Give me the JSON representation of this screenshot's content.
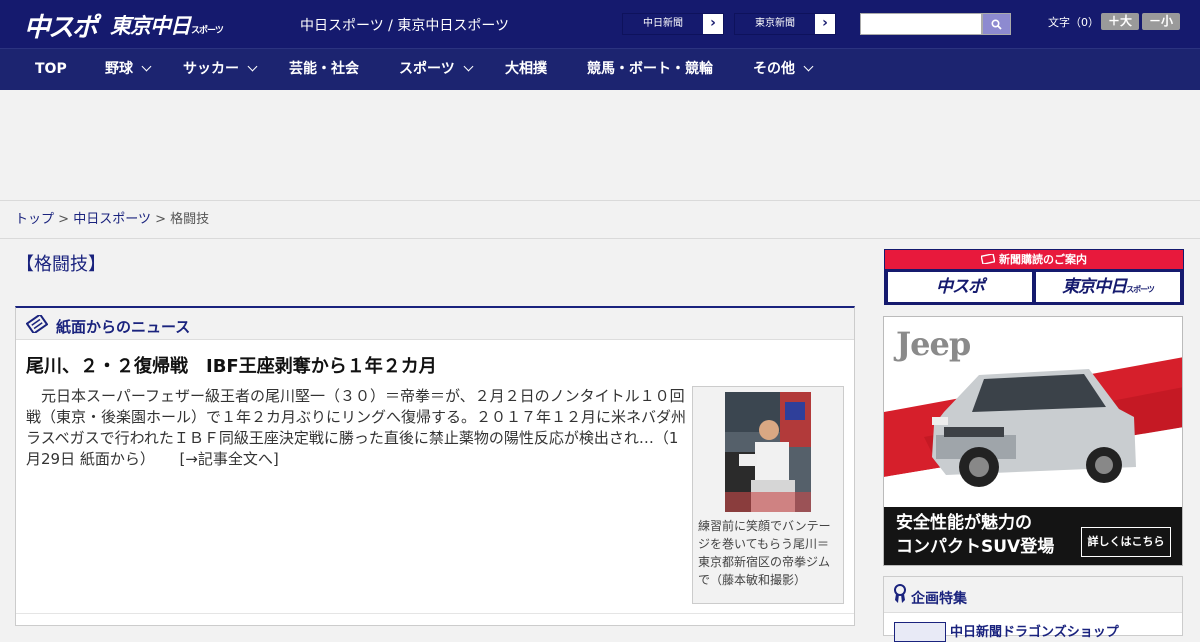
{
  "header": {
    "logo_chuspo": "中スポ",
    "logo_tokyo": "東京中日",
    "logo_tokyo_sub": "スポーツ",
    "site_title": "中日スポーツ / 東京中日スポーツ",
    "paper_links": [
      "中日新聞",
      "東京新聞"
    ],
    "search": {
      "value": "",
      "placeholder": ""
    },
    "font_size": {
      "label": "文字（0）",
      "larger": "＋大",
      "smaller": "－小"
    }
  },
  "nav": {
    "items": [
      {
        "label": "TOP",
        "dropdown": false
      },
      {
        "label": "野球",
        "dropdown": true
      },
      {
        "label": "サッカー",
        "dropdown": true
      },
      {
        "label": "芸能・社会",
        "dropdown": false
      },
      {
        "label": "スポーツ",
        "dropdown": true
      },
      {
        "label": "大相撲",
        "dropdown": false
      },
      {
        "label": "競馬・ボート・競輪",
        "dropdown": false
      },
      {
        "label": "その他",
        "dropdown": true
      }
    ]
  },
  "breadcrumb": {
    "home": "トップ",
    "section": "中日スポーツ",
    "current": "格闘技",
    "sep": ">"
  },
  "page_title": "【格闘技】",
  "news": {
    "panel_title": "紙面からのニュース",
    "article": {
      "title": "尾川、２・２復帰戦　IBF王座剥奪から１年２カ月",
      "body": "元日本スーパーフェザー級王者の尾川堅一（３０）＝帝拳＝が、２月２日のノンタイトル１０回戦（東京・後楽園ホール）で１年２カ月ぶりにリングへ復帰する。２０１７年１２月に米ネバダ州ラスベガスで行われたＩＢＦ同級王座決定戦に勝った直後に禁止薬物の陽性反応が検出され…（1月29日 紙面から）",
      "more": "[→記事全文へ]",
      "photo_caption": "練習前に笑顔でバンテージを巻いてもらう尾川＝東京都新宿区の帝拳ジムで（藤本敏和撮影）"
    }
  },
  "sidebar": {
    "subscribe": {
      "header": "新聞購読のご案内",
      "chuspo": "中スポ",
      "tokyo": "東京中日",
      "tokyo_sub": "スポーツ"
    },
    "ad": {
      "brand": "Jeep",
      "headline_1": "安全性能が魅力の",
      "headline_2": "コンパクトSUV登場",
      "cta": "詳しくはこちら"
    },
    "feature": {
      "title": "企画特集",
      "item": "中日新聞ドラゴンズショップ"
    }
  },
  "colors": {
    "brand_navy": "#151a6e",
    "nav_bg": "#1c2470",
    "link": "#1a237e",
    "subscribe_red": "#e8193c"
  }
}
